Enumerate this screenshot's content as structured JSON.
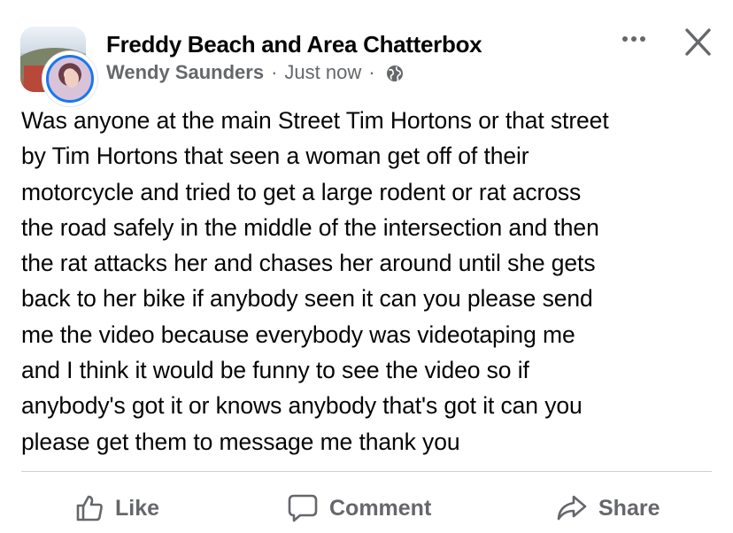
{
  "post": {
    "group_name": "Freddy Beach and Area Chatterbox",
    "author": "Wendy Saunders",
    "separator": "·",
    "timestamp": "Just now",
    "privacy_icon": "globe-icon",
    "body_lines": [
      "Was anyone at the main Street Tim Hortons or that street",
      "by Tim Hortons that seen a woman get off of their",
      "motorcycle and tried to get a large rodent or rat across",
      "the road safely in the middle of the intersection and then",
      "the rat attacks her and chases her around until she gets",
      "back to her bike if anybody seen it can you please send",
      "me the video because everybody was videotaping me",
      "and I think it would be funny to see the video so if",
      "anybody's got it or knows anybody that's got it can you",
      "please get them to message me thank you"
    ]
  },
  "actions": {
    "like_label": "Like",
    "comment_label": "Comment",
    "share_label": "Share"
  },
  "colors": {
    "text": "#050505",
    "secondary": "#65676b",
    "divider": "#ced0d4",
    "accent": "#1877f2"
  }
}
